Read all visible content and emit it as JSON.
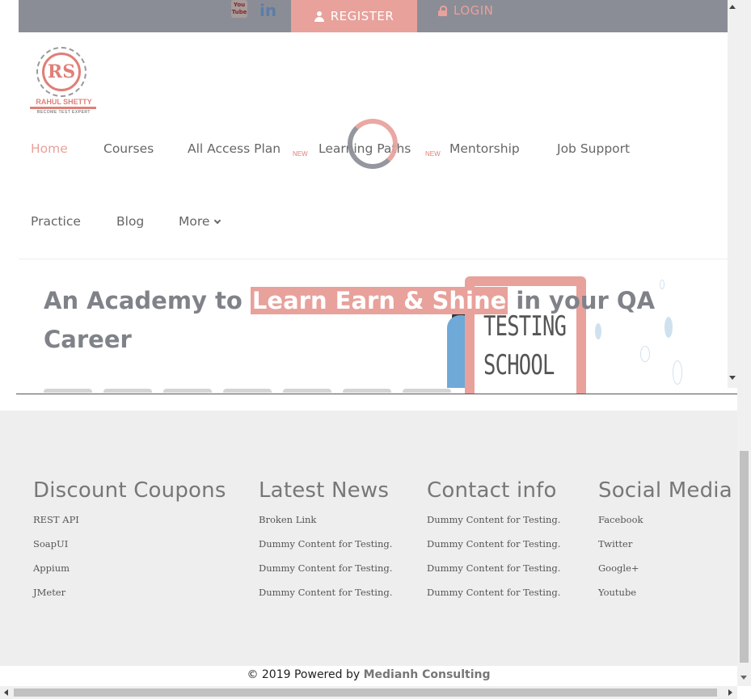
{
  "topbar": {
    "youtube_icon_label": "You Tube",
    "linkedin_icon_label": "in",
    "register_label": "REGISTER",
    "login_label": "LOGIN"
  },
  "logo": {
    "monogram": "RS",
    "name": "RAHUL SHETTY",
    "tagline": "BECOME TEST EXPERT"
  },
  "nav": {
    "items": [
      {
        "label": "Home",
        "active": true
      },
      {
        "label": "Courses"
      },
      {
        "label": "All Access Plan",
        "badge": "NEW"
      },
      {
        "label": "Learning Paths",
        "badge": "NEW"
      },
      {
        "label": "Mentorship"
      },
      {
        "label": "Job Support"
      },
      {
        "label": "Practice"
      },
      {
        "label": "Blog"
      },
      {
        "label": "More"
      }
    ]
  },
  "hero": {
    "heading_before": "An Academy to ",
    "heading_highlight": "Learn Earn & Shine",
    "heading_after": "  in your QA Career",
    "illustration_text_line1": "TESTING",
    "illustration_text_line2": "SCHOOL"
  },
  "footer": {
    "columns": [
      {
        "title": "Discount Coupons",
        "links": [
          "REST API",
          "SoapUI",
          "Appium",
          "JMeter"
        ]
      },
      {
        "title": "Latest News",
        "links": [
          "Broken Link",
          "Dummy Content for Testing.",
          "Dummy Content for Testing.",
          "Dummy Content for Testing."
        ]
      },
      {
        "title": "Contact info",
        "links": [
          "Dummy Content for Testing.",
          "Dummy Content for Testing.",
          "Dummy Content for Testing.",
          "Dummy Content for Testing."
        ]
      },
      {
        "title": "Social Media",
        "links": [
          "Facebook",
          "Twitter",
          "Google+",
          "Youtube"
        ]
      }
    ],
    "copyright_prefix": "© 2019 Powered by ",
    "copyright_brand": "Medianh Consulting"
  },
  "colors": {
    "accent": "#e8a19b",
    "topbar": "#8b8d96",
    "footer_bg": "#eeeeee"
  }
}
